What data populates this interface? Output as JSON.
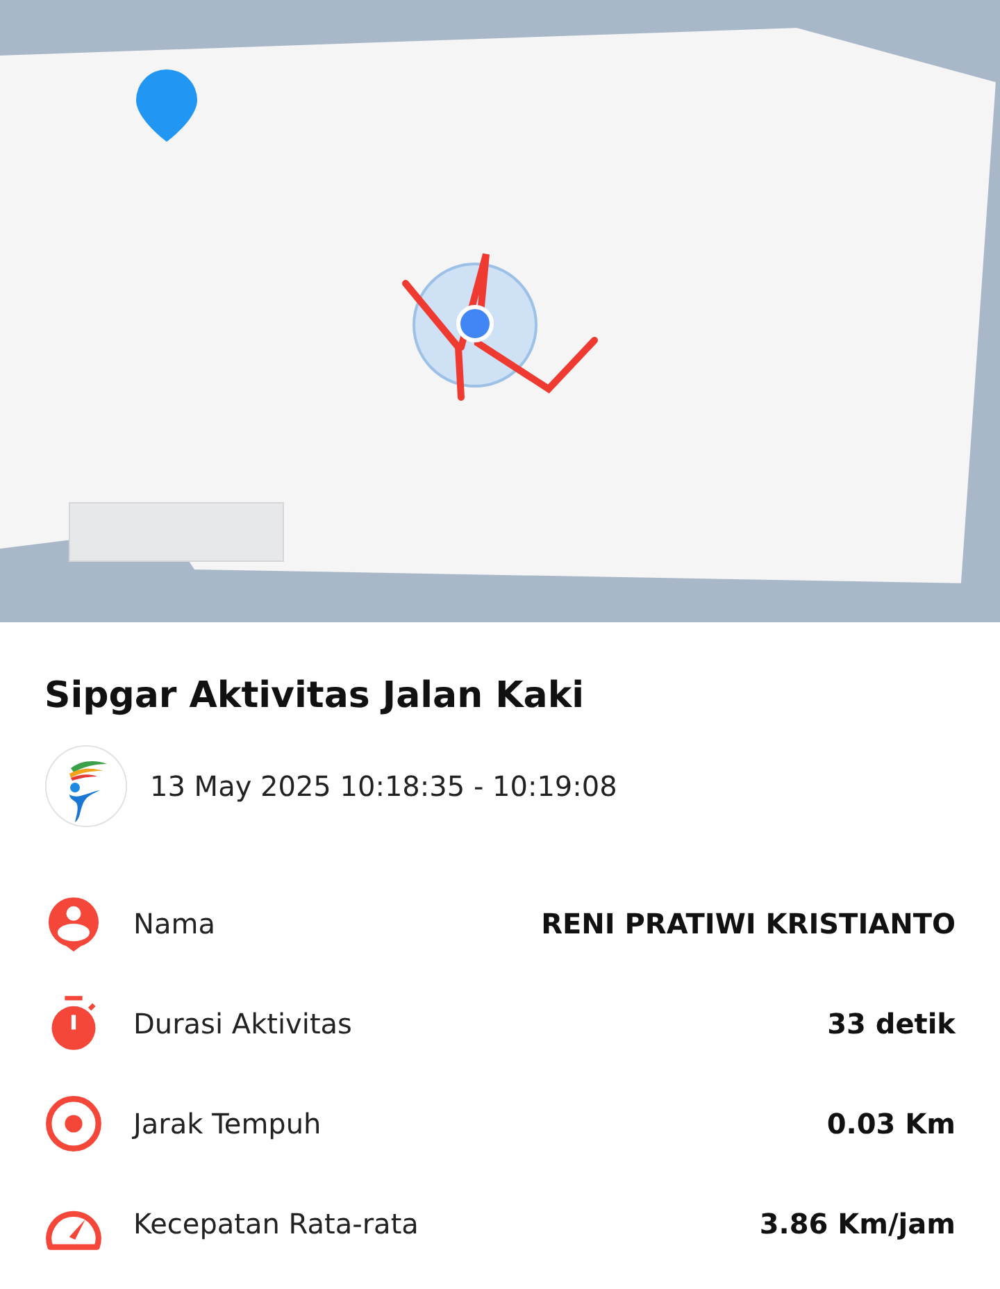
{
  "activity": {
    "title": "Sipgar Aktivitas Jalan Kaki",
    "time_range": "13 May 2025 10:18:35 - 10:19:08"
  },
  "details": [
    {
      "kind": "person",
      "label": "Nama",
      "value": "RENI PRATIWI KRISTIANTO"
    },
    {
      "kind": "timer",
      "label": "Durasi Aktivitas",
      "value": "33 detik"
    },
    {
      "kind": "target",
      "label": "Jarak Tempuh",
      "value": "0.03 Km"
    },
    {
      "kind": "speed",
      "label": "Kecepatan Rata-rata",
      "value": "3.86 Km/jam"
    }
  ]
}
